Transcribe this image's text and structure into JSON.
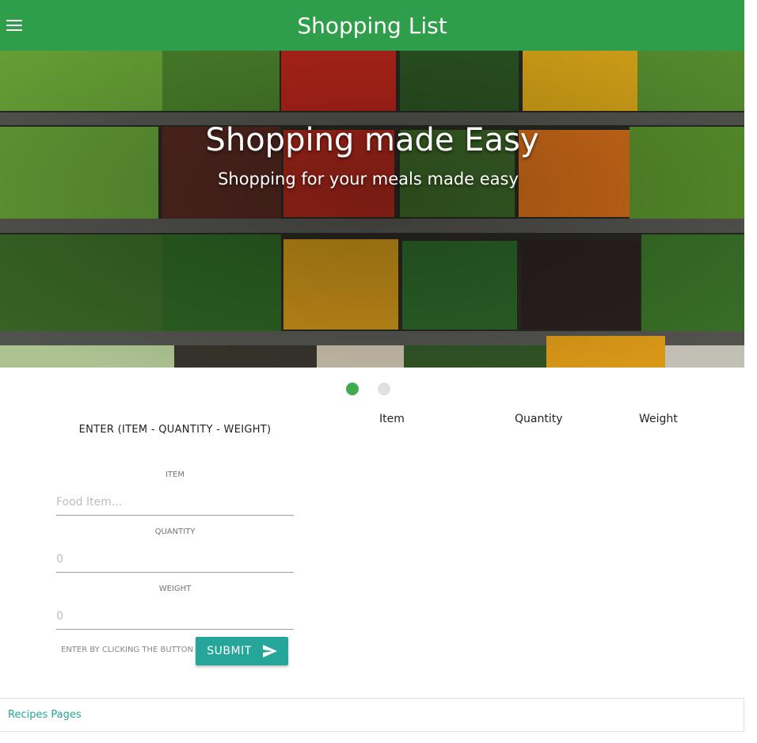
{
  "header": {
    "title": "Shopping List",
    "background": "#2e9e4a"
  },
  "hero": {
    "title": "Shopping made Easy",
    "subtitle": "Shopping for your meals made easy"
  },
  "carousel": {
    "count": 2,
    "active_index": 0,
    "active_color": "#3fab4f",
    "inactive_color": "#e0e0e0"
  },
  "form": {
    "heading": "ENTER (ITEM - QUANTITY - WEIGHT)",
    "item_label": "ITEM",
    "item_placeholder": "Food Item...",
    "quantity_label": "QUANTITY",
    "quantity_placeholder": "0",
    "weight_label": "WEIGHT",
    "weight_placeholder": "0",
    "hint": "ENTER BY CLICKING THE BUTTON",
    "submit_label": "SUBMIT",
    "submit_icon": "send-icon",
    "accent": "#26a69a"
  },
  "table": {
    "columns": [
      "Item",
      "Quantity",
      "Weight"
    ]
  },
  "footer": {
    "link_label": "Recipes Pages"
  }
}
